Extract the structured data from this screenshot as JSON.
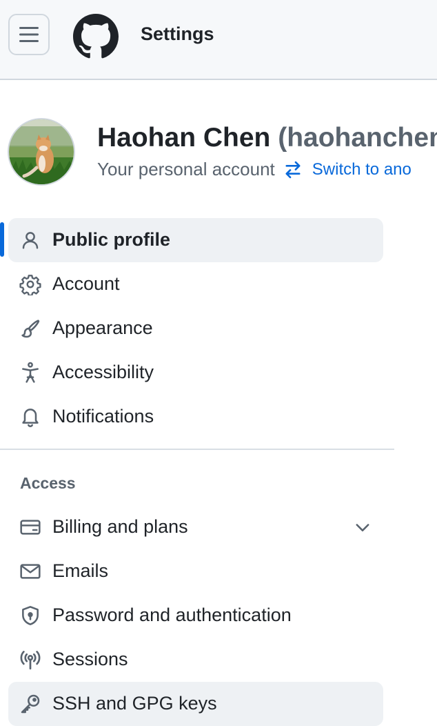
{
  "header": {
    "title": "Settings",
    "menu_icon": "hamburger-icon",
    "logo_icon": "github-mark-icon"
  },
  "profile": {
    "display_name": "Haohan Chen",
    "login": "(haohanchen",
    "subtitle": "Your personal account",
    "switch_link": "Switch to ano"
  },
  "nav": {
    "items": [
      {
        "label": "Public profile",
        "icon": "person-icon",
        "selected": true
      },
      {
        "label": "Account",
        "icon": "gear-icon"
      },
      {
        "label": "Appearance",
        "icon": "paintbrush-icon"
      },
      {
        "label": "Accessibility",
        "icon": "accessibility-icon"
      },
      {
        "label": "Notifications",
        "icon": "bell-icon"
      }
    ],
    "access_heading": "Access",
    "access_items": [
      {
        "label": "Billing and plans",
        "icon": "credit-card-icon",
        "expandable": true
      },
      {
        "label": "Emails",
        "icon": "mail-icon"
      },
      {
        "label": "Password and authentication",
        "icon": "shield-lock-icon"
      },
      {
        "label": "Sessions",
        "icon": "broadcast-icon"
      },
      {
        "label": "SSH and GPG keys",
        "icon": "key-icon",
        "hovered": true
      }
    ]
  },
  "colors": {
    "accent": "#0969da",
    "text": "#1f2328",
    "muted": "#59636e",
    "header_bg": "#f6f8fa",
    "selected_bg": "#eef1f4"
  }
}
